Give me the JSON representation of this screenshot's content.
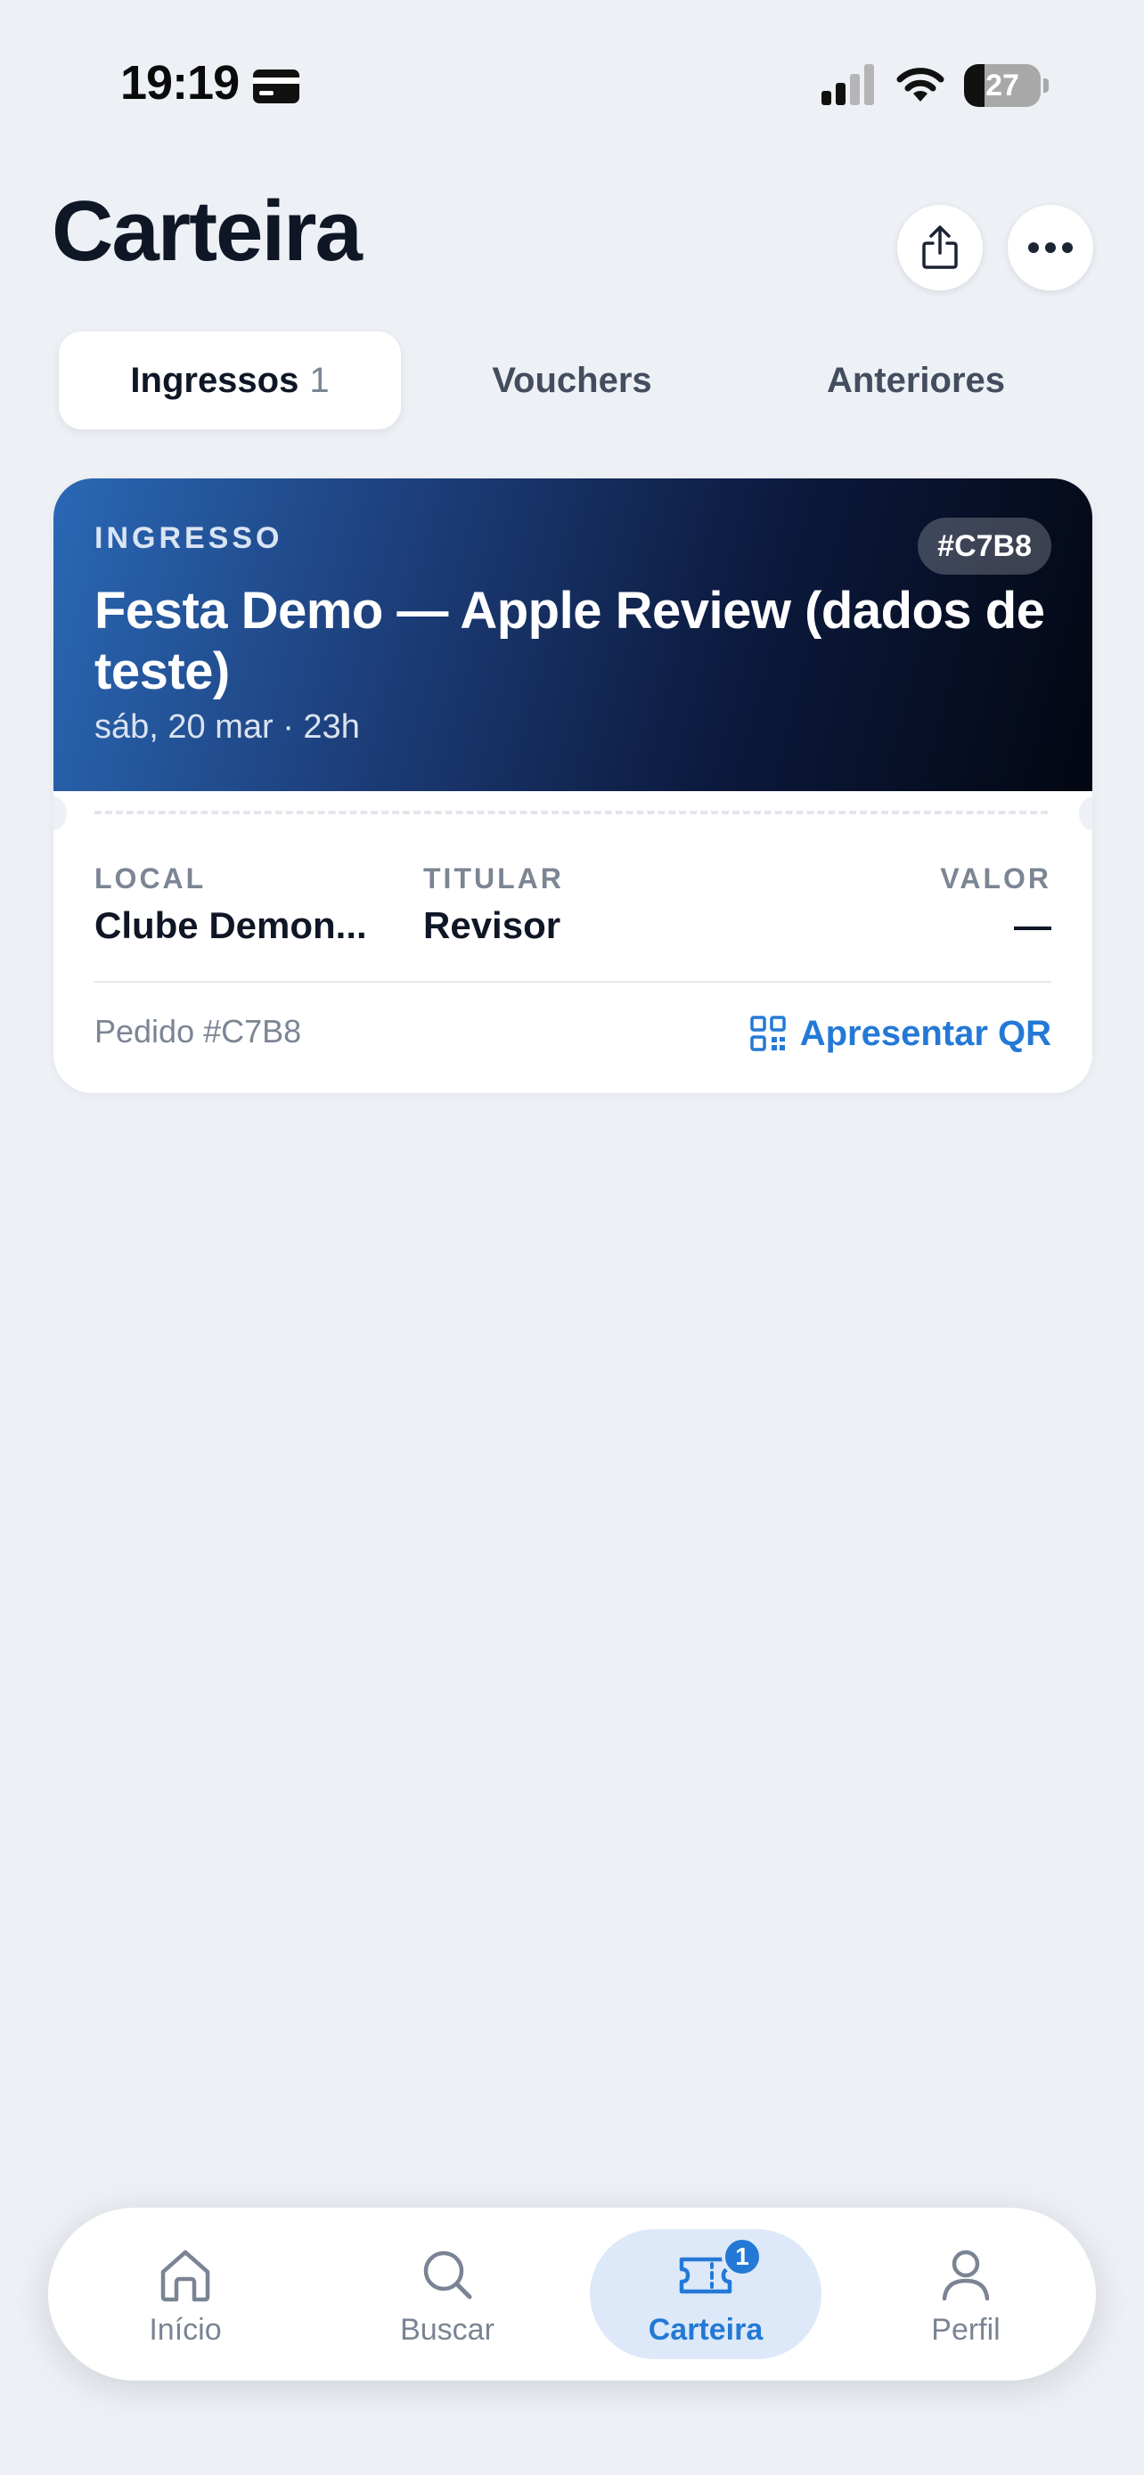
{
  "status_bar": {
    "time": "19:19",
    "battery_percent": "27",
    "battery_level": 0.27,
    "signal_bars_active": 2
  },
  "header": {
    "title": "Carteira",
    "share_icon": "share-icon",
    "more_icon": "more-icon"
  },
  "tabs": [
    {
      "label": "Ingressos",
      "count": "1",
      "active": true
    },
    {
      "label": "Vouchers",
      "active": false
    },
    {
      "label": "Anteriores",
      "active": false
    }
  ],
  "ticket": {
    "kind": "INGRESSO",
    "code": "#C7B8",
    "event_title": "Festa Demo — Apple Review (dados de teste)",
    "date": "sáb, 20 mar · 23h",
    "fields": {
      "local": {
        "label": "LOCAL",
        "value": "Clube Demon..."
      },
      "titular": {
        "label": "TITULAR",
        "value": "Revisor"
      },
      "valor": {
        "label": "VALOR",
        "value": "—"
      }
    },
    "order": "Pedido #C7B8",
    "qr_action": "Apresentar QR",
    "header_gradient": [
      "#2a68b5",
      "#1c3c77",
      "#0c1a3e",
      "#030712"
    ]
  },
  "bottom_nav": {
    "items": [
      {
        "label": "Início",
        "icon": "home-icon"
      },
      {
        "label": "Buscar",
        "icon": "search-icon"
      },
      {
        "label": "Carteira",
        "icon": "ticket-icon",
        "badge": "1",
        "active": true
      },
      {
        "label": "Perfil",
        "icon": "profile-icon"
      }
    ]
  },
  "colors": {
    "background": "#edf0f5",
    "accent": "#2479d6",
    "text_primary": "#0f1726",
    "text_secondary": "#7c8594"
  }
}
